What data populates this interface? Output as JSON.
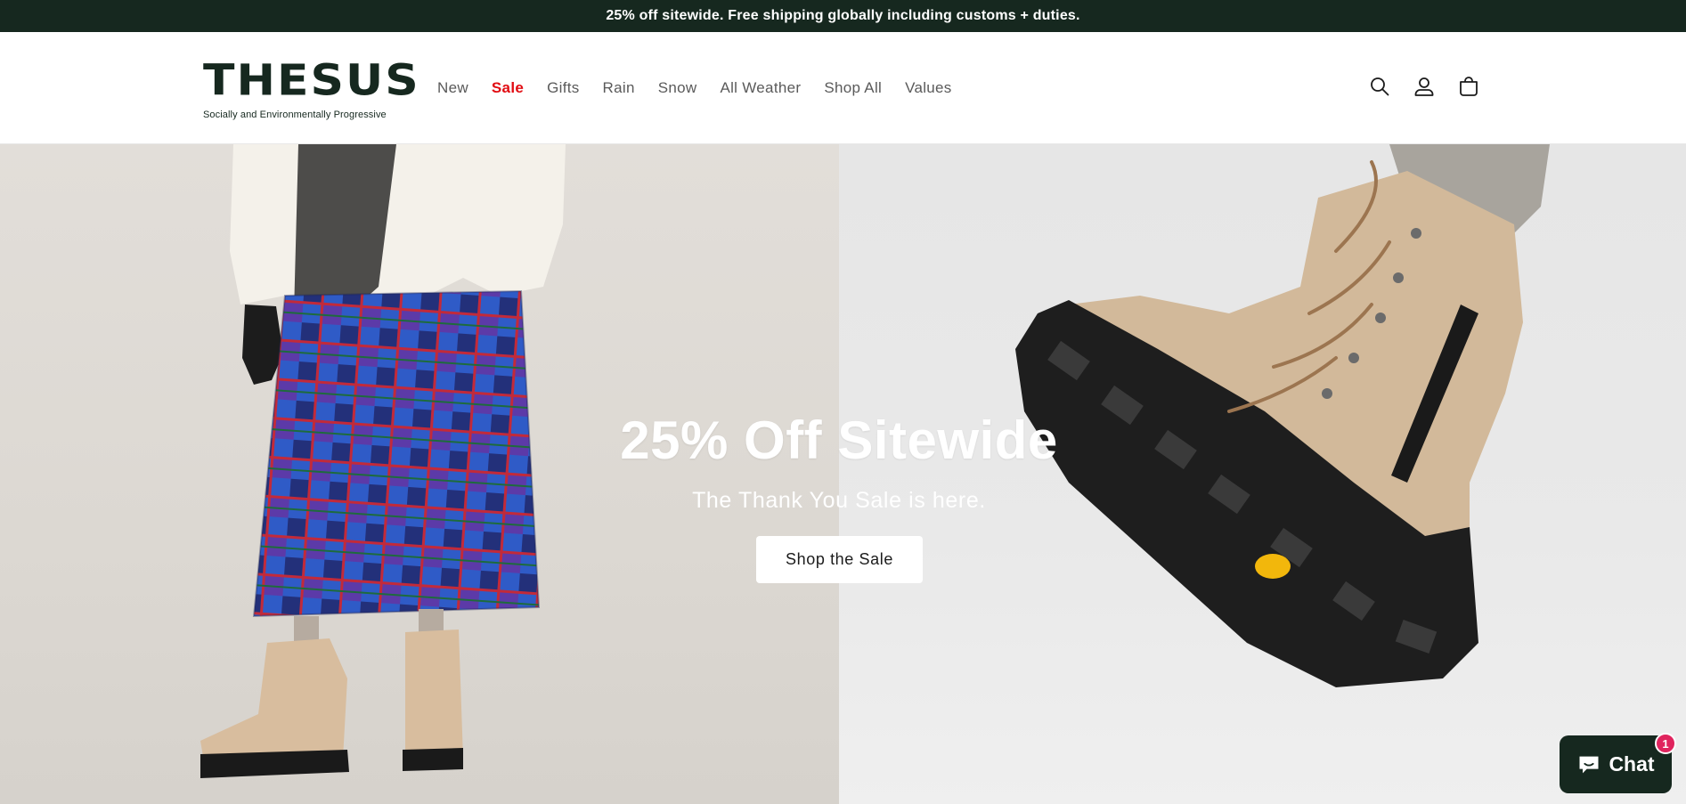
{
  "announcement": {
    "text": "25% off sitewide. Free shipping globally including customs + duties."
  },
  "header": {
    "logo": {
      "word": "THESUS",
      "tagline": "Socially and Environmentally Progressive"
    },
    "nav": [
      {
        "label": "New"
      },
      {
        "label": "Sale",
        "highlight": true
      },
      {
        "label": "Gifts"
      },
      {
        "label": "Rain"
      },
      {
        "label": "Snow"
      },
      {
        "label": "All Weather"
      },
      {
        "label": "Shop All"
      },
      {
        "label": "Values"
      }
    ],
    "icons": [
      "search-icon",
      "account-icon",
      "cart-icon"
    ]
  },
  "hero": {
    "title": "25% Off Sitewide",
    "subtitle": "The Thank You Sale is here.",
    "button_label": "Shop the Sale"
  },
  "chat": {
    "label": "Chat",
    "badge": "1"
  },
  "colors": {
    "brand_dark": "#16281f",
    "sale_red": "#e10c12",
    "badge_pink": "#e0245e"
  }
}
